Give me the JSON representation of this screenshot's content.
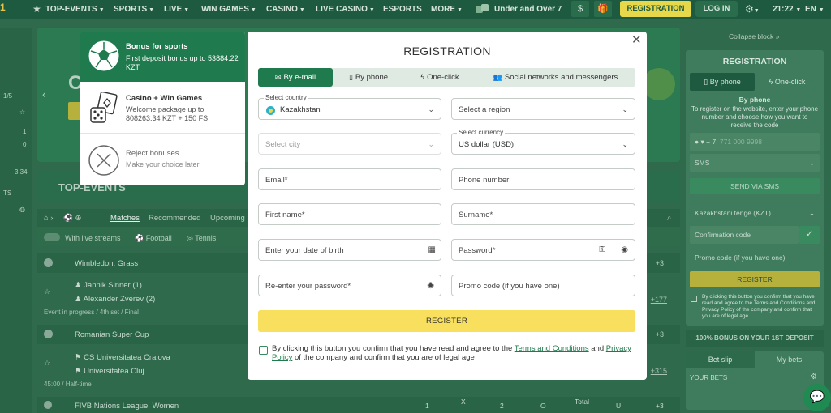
{
  "nav": {
    "items": [
      "TOP-EVENTS",
      "SPORTS",
      "LIVE",
      "WIN GAMES",
      "CASINO",
      "LIVE CASINO",
      "ESPORTS",
      "MORE"
    ],
    "promo_label": "Under and Over 7",
    "register_label": "REGISTRATION",
    "login_label": "LOG IN",
    "time": "21:22",
    "lang": "EN"
  },
  "background": {
    "banner_letter": "C",
    "top_events": "TOP-EVENTS",
    "tabs": [
      "Matches",
      "Recommended",
      "Upcoming"
    ],
    "filters": [
      "With live streams",
      "Football",
      "Tennis"
    ],
    "left_numbers": [
      "1/5",
      "1",
      "0",
      "3.34"
    ],
    "left_label": "TS",
    "groups": [
      {
        "name": "Wimbledon. Grass",
        "count": "+3"
      },
      {
        "name": "Romanian Super Cup",
        "count": "+3"
      },
      {
        "name": "FIVB Nations League. Women",
        "count": "+3"
      }
    ],
    "matches": [
      {
        "team1": "Jannik Sinner (1)",
        "team2": "Alexander Zverev (2)",
        "status": "Event in progress / 4th set / Final",
        "more": "+177"
      },
      {
        "team1": "CS Universitatea Craiova",
        "team2": "Universitatea Cluj",
        "status": "45:00 / Half-time",
        "more": "+315"
      }
    ],
    "bottom_odds": [
      "1",
      "X",
      "2",
      "O",
      "Total",
      "U"
    ]
  },
  "sidebar": {
    "collapse": "Collapse block",
    "title": "REGISTRATION",
    "tab_phone": "By phone",
    "tab_oneclick": "One-click",
    "subtitle": "By phone",
    "hint": "To register on the website, enter your phone number and choose how you want to receive the code",
    "phone_code": "+ 7",
    "phone_placeholder": "771 000 9998",
    "sms": "SMS",
    "send_sms": "SEND VIA SMS",
    "currency": "Kazakhstani tenge (KZT)",
    "confirm_code": "Confirmation code",
    "promo": "Promo code (if you have one)",
    "register": "REGISTER",
    "agree": "By clicking this button you confirm that you have read and agree to the Terms and Conditions and Privacy Policy of the company and confirm that you are of legal age",
    "bonus_bar": "100% BONUS ON YOUR 1ST DEPOSIT",
    "betslip": "Bet slip",
    "mybets": "My bets",
    "your_bets": "YOUR BETS"
  },
  "bonus_card": {
    "sports_title": "Bonus for sports",
    "sports_desc": "First deposit bonus up to 53884.22 KZT",
    "casino_title": "Casino + Win Games",
    "casino_desc": "Welcome package up to 808263.34 KZT + 150 FS",
    "reject_title": "Reject bonuses",
    "reject_desc": "Make your choice later"
  },
  "modal": {
    "title": "REGISTRATION",
    "tabs": [
      "By e-mail",
      "By phone",
      "One-click",
      "Social networks and messengers"
    ],
    "country_label": "Select country",
    "country_value": "Kazakhstan",
    "region_placeholder": "Select a region",
    "city_placeholder": "Select city",
    "currency_label": "Select currency",
    "currency_value": "US dollar (USD)",
    "email_placeholder": "Email*",
    "phone_placeholder": "Phone number",
    "firstname_placeholder": "First name*",
    "surname_placeholder": "Surname*",
    "dob_placeholder": "Enter your date of birth",
    "password_placeholder": "Password*",
    "repassword_placeholder": "Re-enter your password*",
    "promo_placeholder": "Promo code (if you have one)",
    "register_label": "REGISTER",
    "agree_pre": "By clicking this button you confirm that you have read and agree to the ",
    "agree_terms": "Terms and Conditions",
    "agree_and": " and ",
    "agree_privacy": "Privacy Policy",
    "agree_post": " of the company and confirm that you are of legal age"
  }
}
